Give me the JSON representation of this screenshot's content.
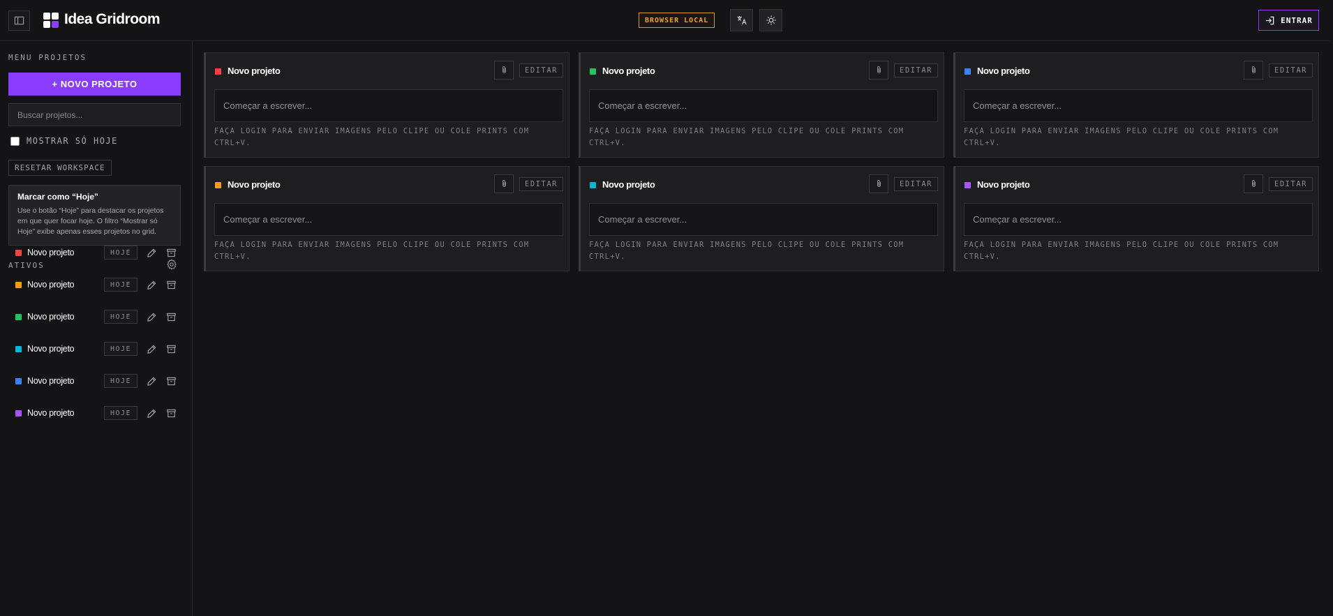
{
  "header": {
    "app_title": "Idea Gridroom",
    "storage_badge": "BROWSER LOCAL",
    "login_label": "ENTRAR"
  },
  "sidebar": {
    "menu_label": "MENU PROJETOS",
    "new_project_label": "+ NOVO PROJETO",
    "search_placeholder": "Buscar projetos...",
    "today_filter_label": "MOSTRAR SÓ HOJE",
    "reset_label": "RESETAR WORKSPACE",
    "hint": {
      "title": "Marcar como “Hoje”",
      "text": "Use o botão “Hoje” para destacar os projetos em que quer focar hoje. O filtro “Mostrar só Hoje” exibe apenas esses projetos no grid."
    },
    "active_label": "ATIVOS",
    "hoje_label": "HOJE",
    "projects": [
      {
        "name": "Novo projeto",
        "color": "#ef4444"
      },
      {
        "name": "Novo projeto",
        "color": "#f59e0b"
      },
      {
        "name": "Novo projeto",
        "color": "#22c55e"
      },
      {
        "name": "Novo projeto",
        "color": "#06b6d4"
      },
      {
        "name": "Novo projeto",
        "color": "#3b82f6"
      },
      {
        "name": "Novo projeto",
        "color": "#a855f7"
      }
    ]
  },
  "cards": [
    {
      "title": "Novo projeto",
      "color": "#ef4444"
    },
    {
      "title": "Novo projeto",
      "color": "#22c55e"
    },
    {
      "title": "Novo projeto",
      "color": "#3b82f6"
    },
    {
      "title": "Novo projeto",
      "color": "#f59e0b"
    },
    {
      "title": "Novo projeto",
      "color": "#06b6d4"
    },
    {
      "title": "Novo projeto",
      "color": "#a855f7"
    }
  ],
  "card_common": {
    "edit_label": "EDITAR",
    "editor_placeholder": "Começar a escrever...",
    "note_line1": "FAÇA LOGIN PARA ENVIAR IMAGENS PELO CLIPE OU COLE PRINTS COM",
    "note_line2": "CTRL+V."
  },
  "colors": {
    "accent": "#8b3dff",
    "badge": "#e9a42a",
    "background": "#141416"
  }
}
